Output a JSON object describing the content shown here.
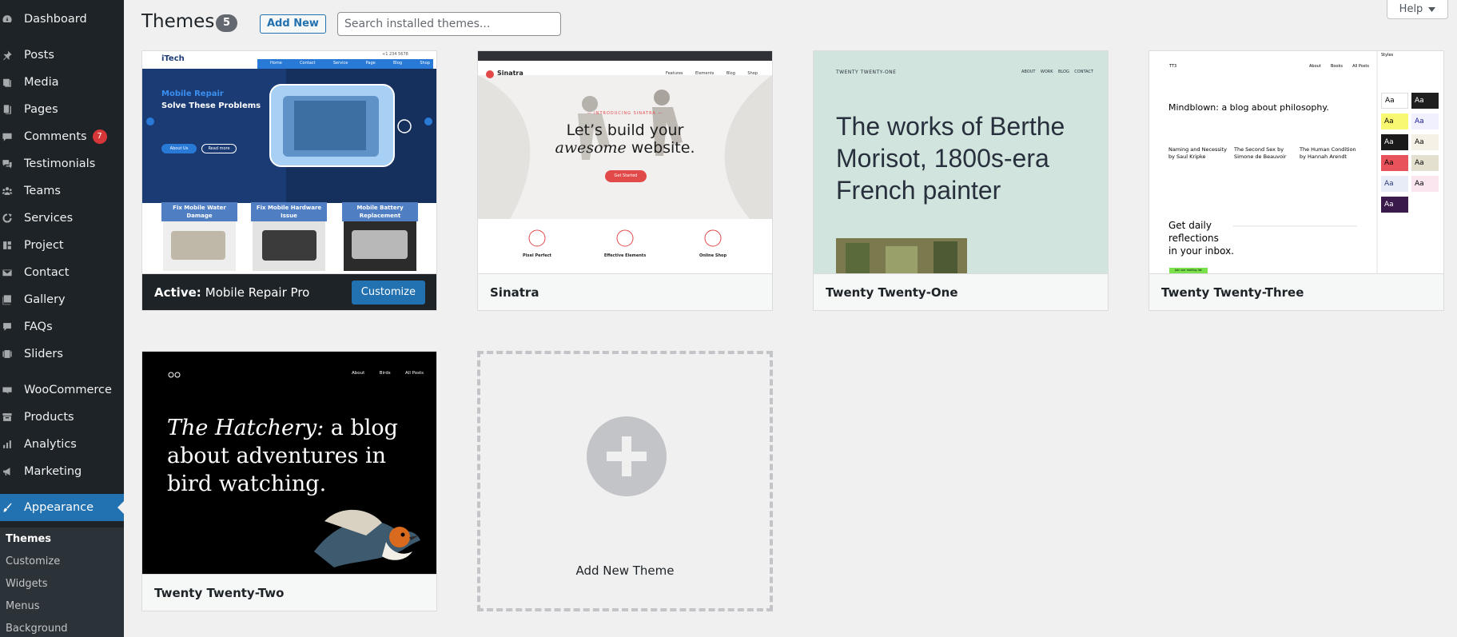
{
  "sidebar": {
    "items": [
      {
        "label": "Dashboard",
        "icon": "dashboard-icon"
      },
      {
        "label": "Posts",
        "icon": "pushpin-icon"
      },
      {
        "label": "Media",
        "icon": "media-icon"
      },
      {
        "label": "Pages",
        "icon": "pages-icon"
      },
      {
        "label": "Comments",
        "icon": "comment-icon",
        "badge": "7"
      },
      {
        "label": "Testimonials",
        "icon": "testimonial-icon"
      },
      {
        "label": "Teams",
        "icon": "groups-icon"
      },
      {
        "label": "Services",
        "icon": "services-icon"
      },
      {
        "label": "Project",
        "icon": "project-icon"
      },
      {
        "label": "Contact",
        "icon": "email-icon"
      },
      {
        "label": "Gallery",
        "icon": "gallery-icon"
      },
      {
        "label": "FAQs",
        "icon": "faq-icon"
      },
      {
        "label": "Sliders",
        "icon": "slides-icon"
      },
      {
        "label": "WooCommerce",
        "icon": "woocommerce-icon"
      },
      {
        "label": "Products",
        "icon": "archive-icon"
      },
      {
        "label": "Analytics",
        "icon": "chart-bar-icon"
      },
      {
        "label": "Marketing",
        "icon": "megaphone-icon"
      },
      {
        "label": "Appearance",
        "icon": "paintbrush-icon",
        "current": true
      }
    ],
    "submenu": [
      "Themes",
      "Customize",
      "Widgets",
      "Menus",
      "Background"
    ]
  },
  "header": {
    "title": "Themes",
    "count": "5",
    "add_new_label": "Add New",
    "search_placeholder": "Search installed themes...",
    "help_label": "Help"
  },
  "themes": [
    {
      "name": "Mobile Repair Pro",
      "active": true,
      "active_label": "Active:",
      "customize_label": "Customize",
      "screenshot": {
        "logo": "iTech",
        "phone": "+1 234 5678",
        "nav": [
          "Home",
          "Contact",
          "Service",
          "Page",
          "Blog",
          "Shop"
        ],
        "heading_accent": "Mobile Repair",
        "heading": "Solve These Problems",
        "btn_primary": "About Us",
        "btn_secondary": "Read more",
        "tiles": [
          "Fix Mobile Water Damage",
          "Fix Mobile Hardware Issue",
          "Mobile Battery Replacement"
        ]
      }
    },
    {
      "name": "Sinatra",
      "active": false,
      "screenshot": {
        "logo": "Sinatra",
        "nav": [
          "Features",
          "Elements",
          "Blog",
          "Shop"
        ],
        "kicker": "— INTRODUCING SINATRA —",
        "headline_1": "Let’s build your",
        "headline_2_italic": "awesome",
        "headline_2_rest": " website.",
        "cta": "Get Started",
        "features": [
          "Pixel Perfect",
          "Effective Elements",
          "Online Shop"
        ]
      }
    },
    {
      "name": "Twenty Twenty-One",
      "active": false,
      "screenshot": {
        "site_title": "TWENTY TWENTY-ONE",
        "nav": [
          "ABOUT",
          "WORK",
          "BLOG",
          "CONTACT"
        ],
        "headline_1": "The works of Berthe",
        "headline_2": "Morisot, 1800s-era",
        "headline_3": "French painter"
      }
    },
    {
      "name": "Twenty Twenty-Three",
      "active": false,
      "screenshot": {
        "site_title": "TT3",
        "nav": [
          "About",
          "Books",
          "All Posts"
        ],
        "headline": "Mindblown: a blog about philosophy.",
        "posts": [
          "Naming and Necessity by Saul Kripke",
          "The Second Sex by Simone de Beauvoir",
          "The Human Condition by Hannah Arendt"
        ],
        "cta_line1": "Get daily",
        "cta_line2": "reflections",
        "cta_line3": "in your inbox.",
        "cta_button": "Join our mailing list",
        "style_sample": "Aa",
        "panel_title": "Styles"
      }
    },
    {
      "name": "Twenty Twenty-Two",
      "active": false,
      "screenshot": {
        "nav": [
          "About",
          "Birds",
          "All Posts"
        ],
        "headline_italic": "The Hatchery:",
        "headline_rest_1": " a blog",
        "headline_rest_2": "about adventures in",
        "headline_rest_3": "bird watching."
      }
    }
  ],
  "add_new_theme": {
    "label": "Add New Theme"
  },
  "colors": {
    "sidebar_bg": "#1d2327",
    "accent": "#2271b1",
    "badge": "#d63638",
    "page_bg": "#f0f0f1"
  }
}
